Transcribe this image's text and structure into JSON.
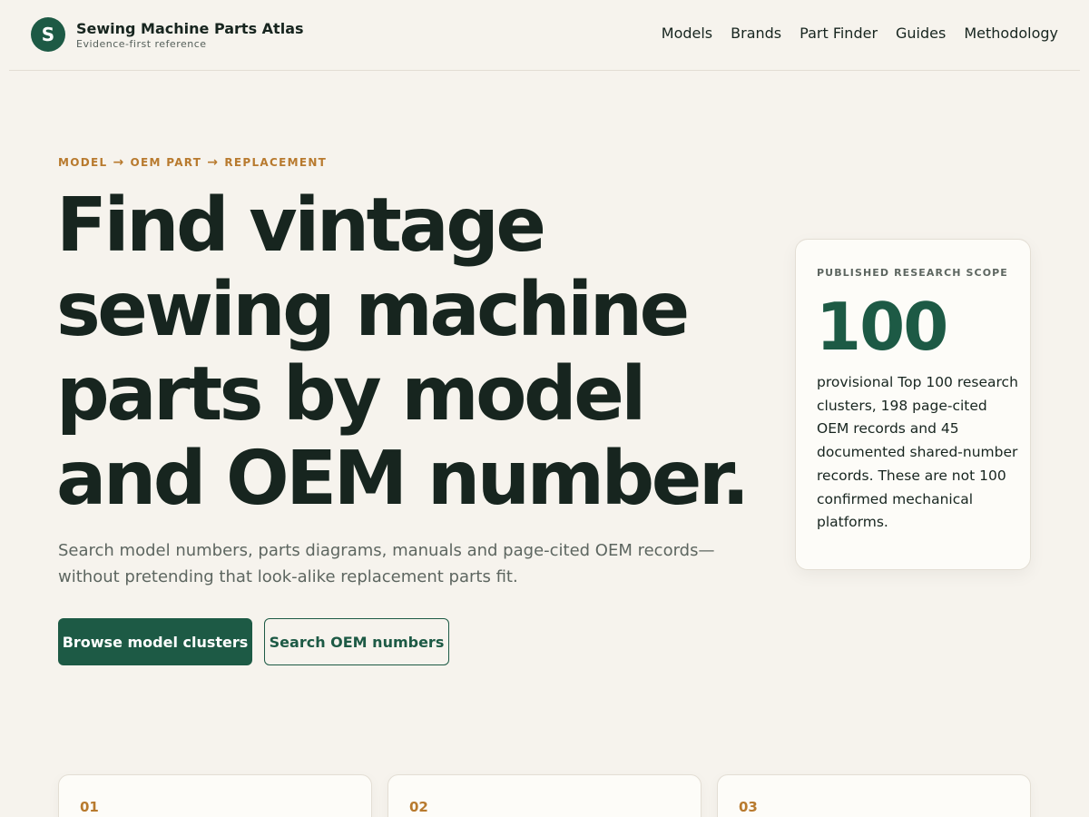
{
  "brand": {
    "logo_letter": "S",
    "title": "Sewing Machine Parts Atlas",
    "subtitle": "Evidence-first reference"
  },
  "nav": {
    "items": [
      "Models",
      "Brands",
      "Part Finder",
      "Guides",
      "Methodology"
    ]
  },
  "hero": {
    "eyebrow": [
      "MODEL",
      "OEM PART",
      "REPLACEMENT"
    ],
    "eyebrow_arrow": "→",
    "headline": "Find vintage sewing machine parts by model and OEM number.",
    "lede": "Search model numbers, parts diagrams, manuals and page-cited OEM records—without pretending that look-alike replacement parts fit.",
    "primary_cta": "Browse model clusters",
    "secondary_cta": "Search OEM numbers"
  },
  "scope_card": {
    "label": "PUBLISHED RESEARCH SCOPE",
    "number": "100",
    "text": "provisional Top 100 research clusters, 198 page-cited OEM records and 45 documented shared-number records. These are not 100 confirmed mechanical platforms."
  },
  "steps": [
    "01",
    "02",
    "03"
  ],
  "colors": {
    "background": "#f6f3ed",
    "accent_green": "#1d5a45",
    "accent_amber": "#b87a2e",
    "text_dark": "#17251f"
  }
}
